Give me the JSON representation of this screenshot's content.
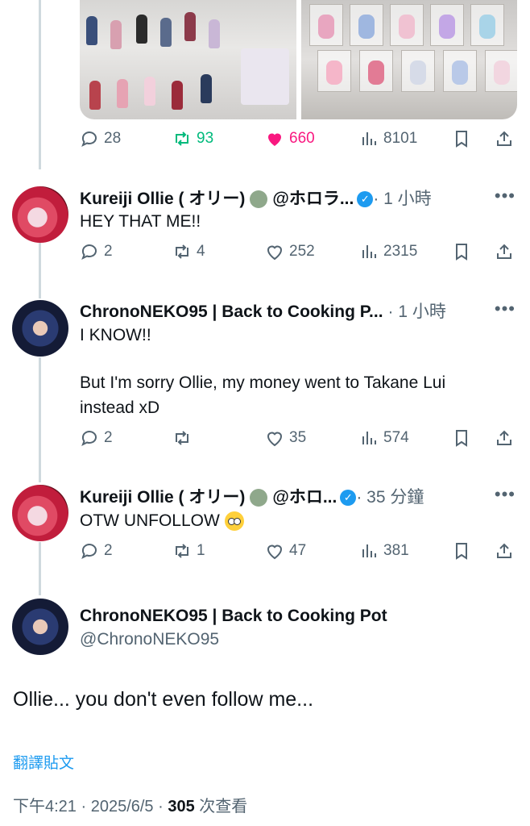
{
  "top_tweet": {
    "stats": {
      "replies": "28",
      "retweets": "93",
      "likes": "660",
      "views": "8101"
    },
    "colors": {
      "retweet_active": "#00ba7c",
      "like_active": "#f91880"
    }
  },
  "replies": [
    {
      "name": "Kureiji Ollie ( オリー)",
      "handle": "@ホロラ...",
      "time": "· 1 小時",
      "text": "HEY THAT ME!!",
      "stats": {
        "replies": "2",
        "retweets": "4",
        "likes": "252",
        "views": "2315"
      }
    },
    {
      "name": "ChronoNEKO95 | Back to Cooking P...",
      "time": "· 1 小時",
      "text_line1": "I KNOW!!",
      "text_line2": "But I'm sorry Ollie, my money went to Takane Lui",
      "text_line3": "instead xD",
      "stats": {
        "replies": "2",
        "retweets": "",
        "likes": "35",
        "views": "574"
      }
    },
    {
      "name": "Kureiji Ollie ( オリー)",
      "handle": "@ホロ...",
      "time": "· 35 分鐘",
      "text": "OTW UNFOLLOW",
      "stats": {
        "replies": "2",
        "retweets": "1",
        "likes": "47",
        "views": "381"
      }
    }
  ],
  "main_tweet": {
    "name": "ChronoNEKO95 | Back to Cooking Pot",
    "handle": "@ChronoNEKO95",
    "text": "Ollie... you don't even follow me...",
    "translate": "翻譯貼文",
    "timestamp": "下午4:21 · 2025/6/5 · ",
    "views_count": "305",
    "views_label": " 次查看"
  },
  "icons": [
    "reply-icon",
    "retweet-icon",
    "heart-icon",
    "views-icon",
    "bookmark-icon",
    "share-icon",
    "more-icon",
    "verified-icon"
  ],
  "accent": "#1d9bf0"
}
